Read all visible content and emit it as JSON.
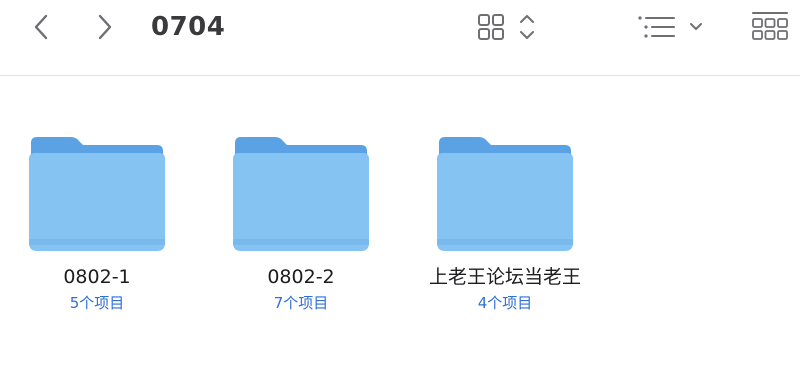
{
  "window": {
    "title": "0704"
  },
  "toolbar": {
    "back_icon": "chevron-left-icon",
    "forward_icon": "chevron-right-icon",
    "view_mode_icon": "icon-grid-icon",
    "group_icon": "list-group-icon",
    "gallery_icon": "gallery-icon"
  },
  "folders": [
    {
      "name": "0802-1",
      "count": "5个项目"
    },
    {
      "name": "0802-2",
      "count": "7个项目"
    },
    {
      "name": "上老王论坛当老王",
      "count": "4个项目"
    }
  ],
  "colors": {
    "folder_back": "#5aa2e3",
    "folder_front": "#84c3f2",
    "count_text": "#2f6fd8"
  }
}
